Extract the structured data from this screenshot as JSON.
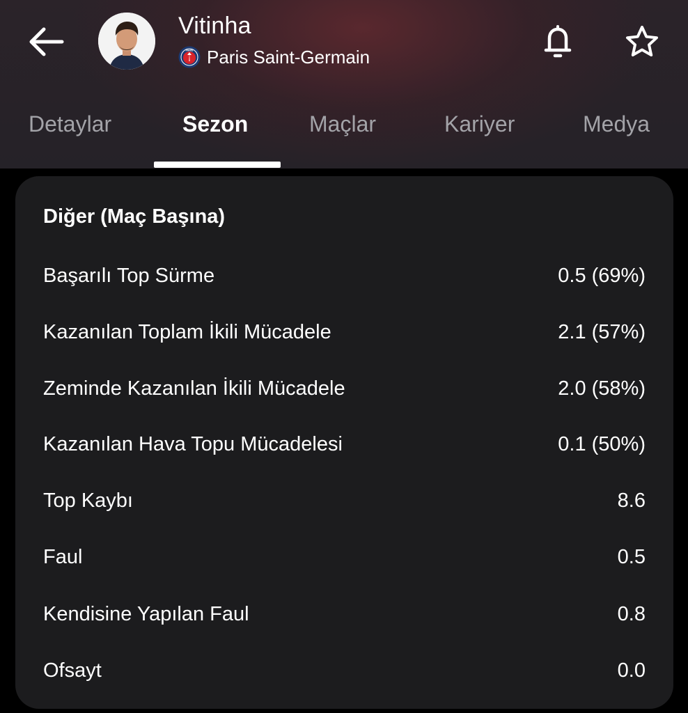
{
  "header": {
    "player_name": "Vitinha",
    "club_name": "Paris Saint-Germain",
    "club_logo_text": "PARIS"
  },
  "icons": {
    "back": "arrow-left-icon",
    "notifications": "bell-icon",
    "favorite": "star-outline-icon"
  },
  "tabs": [
    {
      "label": "Detaylar",
      "active": false
    },
    {
      "label": "Sezon",
      "active": true
    },
    {
      "label": "Maçlar",
      "active": false
    },
    {
      "label": "Kariyer",
      "active": false
    },
    {
      "label": "Medya",
      "active": false
    }
  ],
  "stats_card": {
    "title": "Diğer (Maç Başına)",
    "rows": [
      {
        "label": "Başarılı Top Sürme",
        "value": "0.5 (69%)"
      },
      {
        "label": "Kazanılan Toplam İkili Mücadele",
        "value": "2.1 (57%)"
      },
      {
        "label": "Zeminde Kazanılan İkili Mücadele",
        "value": "2.0 (58%)"
      },
      {
        "label": "Kazanılan Hava Topu Mücadelesi",
        "value": "0.1 (50%)"
      },
      {
        "label": "Top Kaybı",
        "value": "8.6"
      },
      {
        "label": "Faul",
        "value": "0.5"
      },
      {
        "label": "Kendisine Yapılan Faul",
        "value": "0.8"
      },
      {
        "label": "Ofsayt",
        "value": "0.0"
      }
    ]
  },
  "colors": {
    "background": "#000000",
    "header_bg": "#252228",
    "card_bg": "#1c1c1e",
    "text_primary": "#ffffff",
    "text_inactive_tab": "#a3a3a8",
    "psg_navy": "#1b3a73",
    "psg_red": "#d8232a"
  }
}
